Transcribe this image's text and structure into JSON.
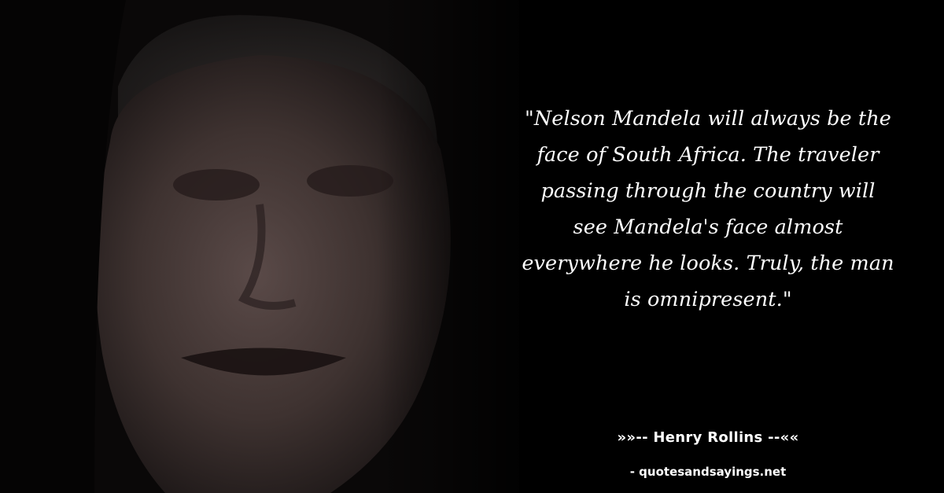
{
  "quote": {
    "lines": [
      "\"Nelson Mandela will always be the",
      "face of South Africa. The traveler",
      "passing through the country will",
      "see Mandela's face almost",
      "everywhere he looks. Truly, the man",
      "is omnipresent.\""
    ]
  },
  "author": {
    "text": "»»-- Henry Rollins --««"
  },
  "source": {
    "text": "- quotesandsayings.net"
  },
  "colors": {
    "background": "#020202",
    "text": "#ffffff"
  }
}
